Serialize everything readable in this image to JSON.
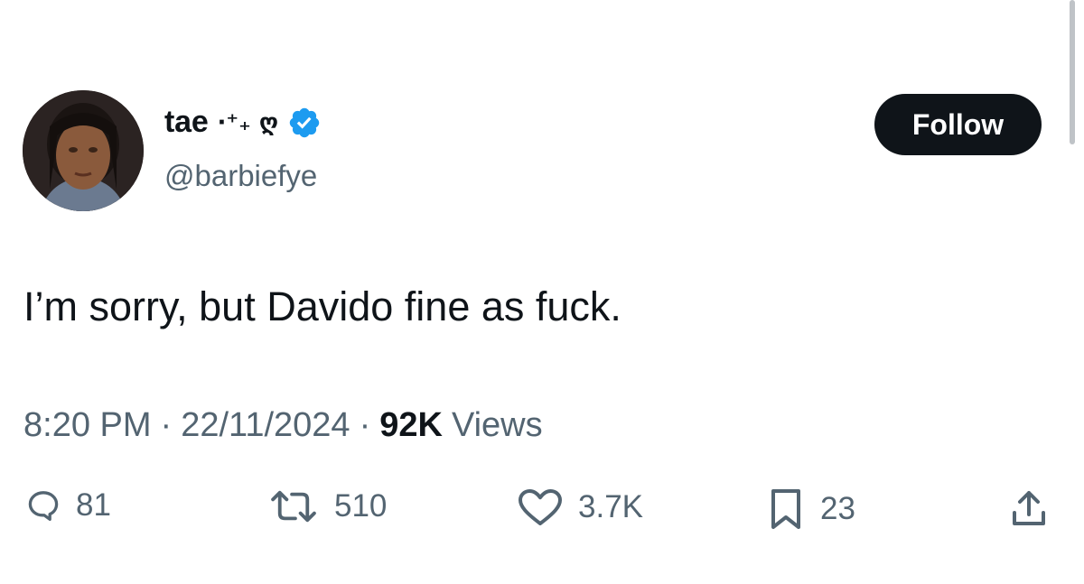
{
  "author": {
    "display_name": "tae",
    "name_decoration": "·⁺₊ ღ",
    "handle": "@barbiefye",
    "verified": true
  },
  "follow_button": {
    "label": "Follow"
  },
  "tweet": {
    "text": "I’m sorry, but Davido fine as fuck.",
    "time": "8:20 PM",
    "date": "22/11/2024",
    "views_count": "92K",
    "views_label": "Views",
    "separator": "·"
  },
  "actions": {
    "replies": "81",
    "reposts": "510",
    "likes": "3.7K",
    "bookmarks": "23"
  },
  "icons": {
    "reply": "reply-icon",
    "repost": "repost-icon",
    "like": "heart-icon",
    "bookmark": "bookmark-icon",
    "share": "share-icon",
    "verified": "verified-badge-icon"
  },
  "colors": {
    "text_primary": "#0f1419",
    "text_secondary": "#536471",
    "verified_blue": "#1d9bf0",
    "button_bg": "#0f1419"
  }
}
